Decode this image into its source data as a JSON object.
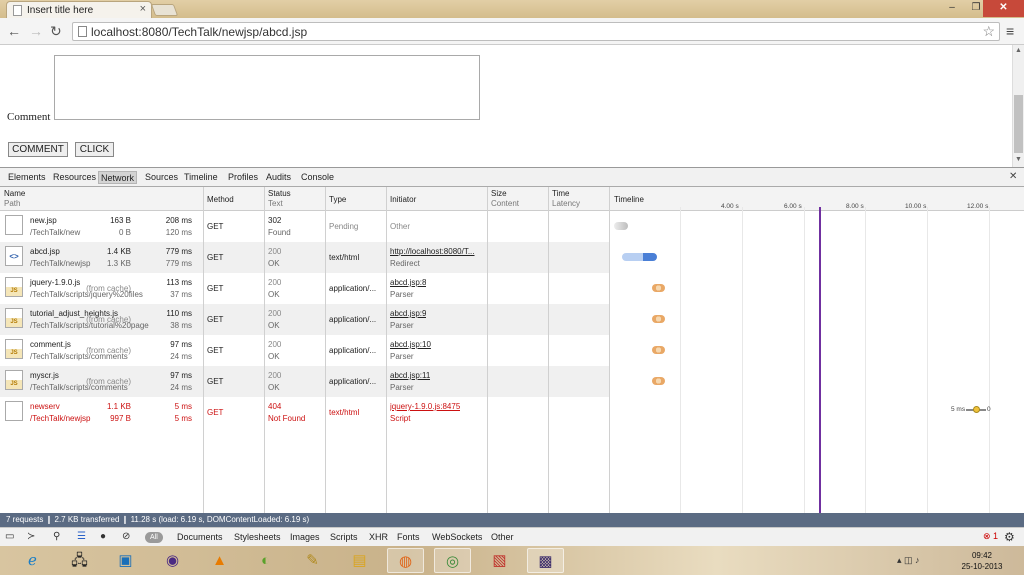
{
  "browser": {
    "tab_title": "Insert title here",
    "url": "localhost:8080/TechTalk/newjsp/abcd.jsp",
    "window_buttons": {
      "minimize": "–",
      "maximize": "❐",
      "close": "✕"
    }
  },
  "page": {
    "comment_label": "Comment",
    "comment_button": "COMMENT",
    "click_button": "CLICK"
  },
  "devtools": {
    "tabs": [
      "Elements",
      "Resources",
      "Network",
      "Sources",
      "Timeline",
      "Profiles",
      "Audits",
      "Console"
    ],
    "active_tab": "Network",
    "columns": {
      "name": "Name",
      "path": "Path",
      "method": "Method",
      "status": "Status",
      "text": "Text",
      "type": "Type",
      "initiator": "Initiator",
      "size": "Size",
      "content": "Content",
      "time": "Time",
      "latency": "Latency",
      "timeline": "Timeline"
    },
    "timeline_ticks": [
      "4.00 s",
      "6.00 s",
      "8.00 s",
      "10.00 s",
      "12.00 s"
    ],
    "requests": [
      {
        "name": "new.jsp",
        "path": "/TechTalk/new",
        "method": "GET",
        "status": "302",
        "status_text": "Found",
        "type": "Pending",
        "initiator": "Other",
        "initiator_sub": "",
        "size": "163 B",
        "content": "0 B",
        "time": "208 ms",
        "latency": "120 ms",
        "icon": "file-icon",
        "bar_start": 0.0,
        "bar_end": 0.2
      },
      {
        "name": "abcd.jsp",
        "path": "/TechTalk/newjsp",
        "method": "GET",
        "status": "200",
        "status_text": "OK",
        "type": "text/html",
        "initiator": "http://localhost:8080/T...",
        "initiator_sub": "Redirect",
        "size": "1.4 KB",
        "content": "1.3 KB",
        "time": "779 ms",
        "latency": "779 ms",
        "icon": "html-icon",
        "bar_start": 0.2,
        "bar_end": 1.0
      },
      {
        "name": "jquery-1.9.0.js",
        "path": "/TechTalk/scripts/jquery%20files",
        "method": "GET",
        "status": "200",
        "status_text": "OK",
        "type": "application/...",
        "initiator": "abcd.jsp:8",
        "initiator_sub": "Parser",
        "size": "(from cache)",
        "content": "",
        "time": "113 ms",
        "latency": "37 ms",
        "icon": "js-icon",
        "bar_start": 1.0,
        "bar_end": 1.1
      },
      {
        "name": "tutorial_adjust_heights.js",
        "path": "/TechTalk/scripts/tutorial%20page",
        "method": "GET",
        "status": "200",
        "status_text": "OK",
        "type": "application/...",
        "initiator": "abcd.jsp:9",
        "initiator_sub": "Parser",
        "size": "(from cache)",
        "content": "",
        "time": "110 ms",
        "latency": "38 ms",
        "icon": "js-icon",
        "bar_start": 1.0,
        "bar_end": 1.1
      },
      {
        "name": "comment.js",
        "path": "/TechTalk/scripts/comments",
        "method": "GET",
        "status": "200",
        "status_text": "OK",
        "type": "application/...",
        "initiator": "abcd.jsp:10",
        "initiator_sub": "Parser",
        "size": "(from cache)",
        "content": "",
        "time": "97 ms",
        "latency": "24 ms",
        "icon": "js-icon",
        "bar_start": 1.0,
        "bar_end": 1.1
      },
      {
        "name": "myscr.js",
        "path": "/TechTalk/scripts/comments",
        "method": "GET",
        "status": "200",
        "status_text": "OK",
        "type": "application/...",
        "initiator": "abcd.jsp:11",
        "initiator_sub": "Parser",
        "size": "(from cache)",
        "content": "",
        "time": "97 ms",
        "latency": "24 ms",
        "icon": "js-icon",
        "bar_start": 1.0,
        "bar_end": 1.1
      },
      {
        "name": "newserv",
        "path": "/TechTalk/newjsp",
        "method": "GET",
        "status": "404",
        "status_text": "Not Found",
        "type": "text/html",
        "initiator": "jquery-1.9.0.js:8475",
        "initiator_sub": "Script",
        "size": "1.1 KB",
        "content": "997 B",
        "time": "5 ms",
        "latency": "5 ms",
        "icon": "file-icon",
        "bar_start": 11.28,
        "bar_end": 11.29,
        "error": true
      }
    ],
    "newserv_bar_label_left": "5 ms",
    "newserv_bar_label_right": "0",
    "summary": "7 requests ❙ 2.7 KB transferred ❙ 11.28 s (load: 6.19 s, DOMContentLoaded: 6.19 s)",
    "filter_all": "All",
    "filters": [
      "Documents",
      "Stylesheets",
      "Images",
      "Scripts",
      "XHR",
      "Fonts",
      "WebSockets",
      "Other"
    ],
    "error_count": "1"
  },
  "taskbar": {
    "time": "09:42",
    "date": "25-10-2013"
  },
  "colors": {
    "status_bar": "#5b6b83",
    "error_red": "#cc1111",
    "load_line": "#7030a0"
  }
}
